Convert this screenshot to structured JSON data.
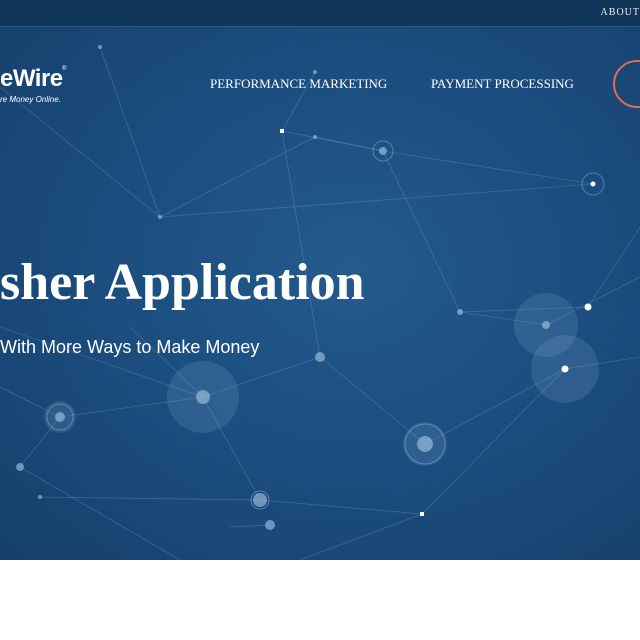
{
  "topbar": {
    "about_label": "ABOUT"
  },
  "logo": {
    "wordmark": "eWire",
    "registered": "®",
    "tagline": "re Money Online."
  },
  "nav": {
    "performance_marketing": "PERFORMANCE MARKETING",
    "payment_processing": "PAYMENT PROCESSING"
  },
  "hero": {
    "headline": "sher Application",
    "subheadline": "With More Ways to Make Money"
  },
  "colors": {
    "topbar": "#0f3558",
    "hero_background": "#1c4e80",
    "accent_ring": "#e06a4f",
    "text": "#ffffff"
  }
}
